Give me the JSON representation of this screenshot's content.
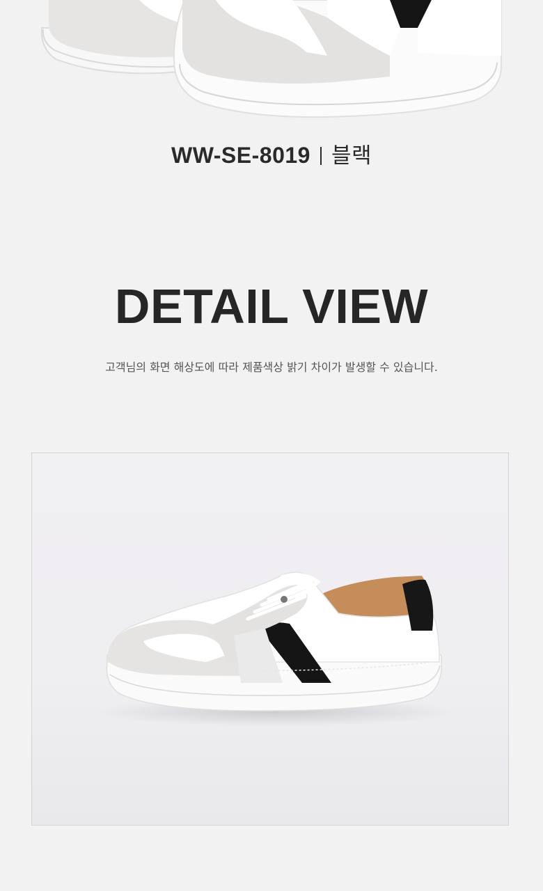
{
  "product": {
    "code": "WW-SE-8019",
    "color": "블랙"
  },
  "section": {
    "title": "DETAIL VIEW",
    "notice": "고객님의 화면 해상도에 따라 제품색상 밝기 차이가 발생할 수 있습니다."
  },
  "colors": {
    "background": "#f3f2f2",
    "text_dark": "#262626",
    "shoe_white": "#ffffff",
    "suede_gray": "#e3e2e0",
    "stripe_black": "#151515",
    "lining_tan": "#c48d5a"
  }
}
